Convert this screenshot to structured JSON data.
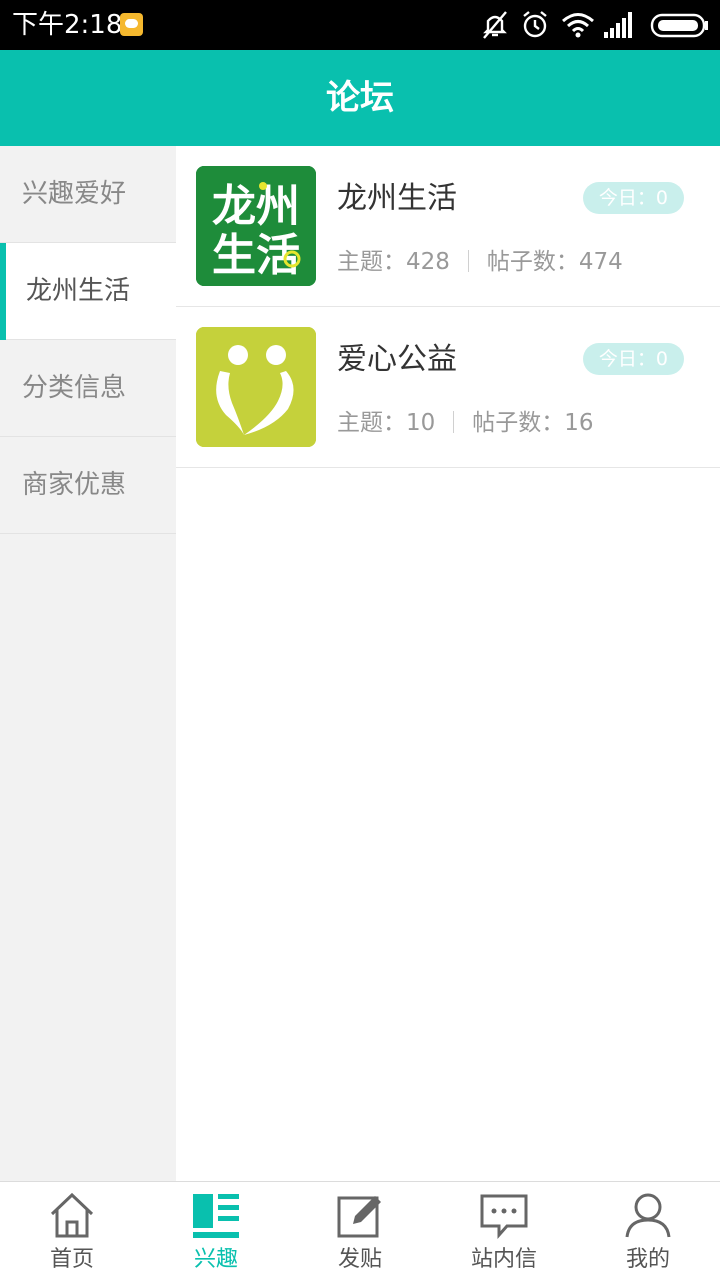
{
  "status_bar": {
    "time": "下午2:18",
    "icons": [
      "message-notification-icon",
      "mute-icon",
      "alarm-icon",
      "wifi-icon",
      "signal-icon",
      "battery-icon"
    ]
  },
  "header": {
    "title": "论坛"
  },
  "sidebar": {
    "items": [
      {
        "label": "兴趣爱好",
        "active": false
      },
      {
        "label": "龙州生活",
        "active": true
      },
      {
        "label": "分类信息",
        "active": false
      },
      {
        "label": "商家优惠",
        "active": false
      }
    ]
  },
  "forums": [
    {
      "name": "龙州生活",
      "today": "今日：0",
      "topics": "主题：428",
      "posts": "帖子数：474",
      "icon": {
        "name": "longzhou-life-logo",
        "bg": "#1e8c3a",
        "text_line1": "龙州",
        "text_line2": "生活"
      }
    },
    {
      "name": "爱心公益",
      "today": "今日：0",
      "topics": "主题：10",
      "posts": "帖子数：16",
      "icon": {
        "name": "charity-heart-logo",
        "bg": "#c5d13b"
      }
    }
  ],
  "tab_bar": {
    "tabs": [
      {
        "label": "首页",
        "icon": "home-icon",
        "active": false
      },
      {
        "label": "兴趣",
        "icon": "interest-list-icon",
        "active": true
      },
      {
        "label": "发贴",
        "icon": "compose-icon",
        "active": false
      },
      {
        "label": "站内信",
        "icon": "message-icon",
        "active": false
      },
      {
        "label": "我的",
        "icon": "profile-icon",
        "active": false
      }
    ]
  },
  "colors": {
    "accent": "#09c0ae",
    "badge_bg": "#c9efec",
    "sidebar_bg": "#f2f2f2"
  }
}
